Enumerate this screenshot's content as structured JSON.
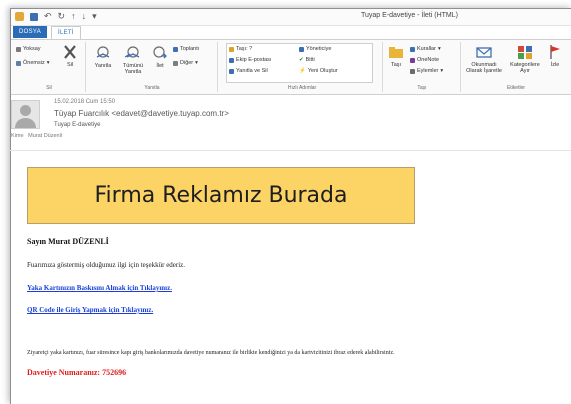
{
  "window": {
    "title": "Tuyap E-davetiye - İleti (HTML)"
  },
  "tabs": [
    {
      "label": "DOSYA"
    },
    {
      "label": "İLETİ"
    }
  ],
  "ribbon": {
    "delete_group": {
      "label": "Sil",
      "ignore": "Yoksay",
      "junk": "Önemsiz",
      "delete": "Sil"
    },
    "respond_group": {
      "label": "Yanıtla",
      "reply": "Yanıtla",
      "reply_all": "Tümünü Yanıtla",
      "forward": "İlet",
      "meeting": "Toplantı",
      "more": "Diğer"
    },
    "quicksteps_group": {
      "label": "Hızlı Adımlar",
      "items": [
        "Taşı: ?",
        "Ekip E-postası",
        "Yanıtla ve Sil",
        "Yöneticiye",
        "Bitti",
        "Yeni Oluştur"
      ]
    },
    "move_group": {
      "label": "Taşı",
      "move": "Taşı",
      "rules": "Kurallar",
      "onenote": "OneNote",
      "actions": "Eylemler"
    },
    "tags_group": {
      "label": "Etiketler",
      "mark_unread": "Okunmadı Olarak İşaretle",
      "categorize": "Kategorilere Ayır",
      "followup": "İzle"
    }
  },
  "header": {
    "date": "15.02.2018 Cum 15:50",
    "from": "Tüyap Fuarcılık <edavet@davetiye.tuyap.com.tr>",
    "subject": "Tuyap E-davetiye",
    "to_label": "Kime",
    "to_value": "Murat Düzenli"
  },
  "body": {
    "banner": "Firma Reklamız Burada",
    "greeting": "Sayın Murat DÜZENLİ",
    "para1": "Fuarımıza göstermiş olduğunuz ilgi için teşekkür ederiz.",
    "link1": "Yaka Kartınızın Baskısını Almak için Tıklayınız.",
    "link2": "QR Code ile Giriş Yapmak için Tıklayınız.",
    "para2": "Ziyaretçi yaka kartınızı, fuar süresince kapı giriş bankolarımızda davetiye numaranız ile birlikte kendiğinizi ya da kartvizitinizi ibraz ederek alabilirsiniz.",
    "invitation": "Davetiye Numaranız: 752696"
  },
  "colors": {
    "accent": "#2b6cb7",
    "banner_bg": "#fcd466",
    "link": "#1a3fd8",
    "invitation": "#e01b1b"
  }
}
